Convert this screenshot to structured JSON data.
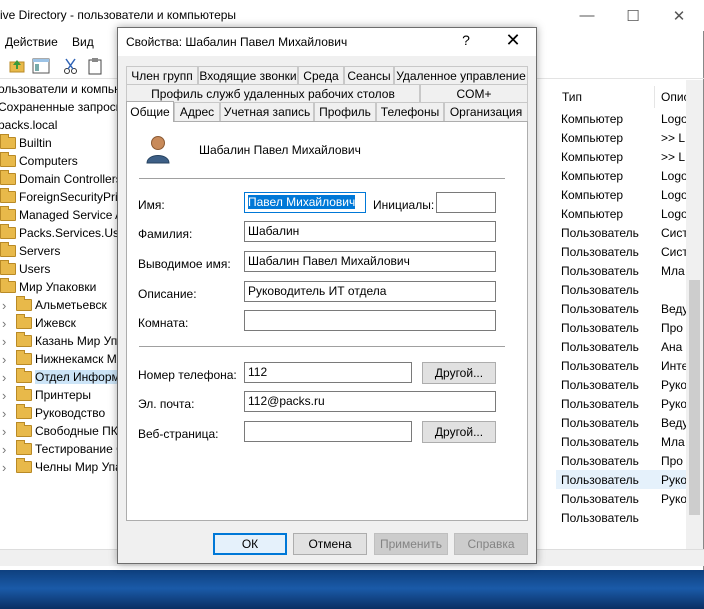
{
  "main_window": {
    "title": "ive Directory - пользователи и компьютеры",
    "menu": [
      "Действие",
      "Вид"
    ],
    "tree": [
      {
        "label": "ользователи и компьют",
        "indent": 0,
        "folder": false
      },
      {
        "label": "Сохраненные запросы",
        "indent": 0,
        "folder": false
      },
      {
        "label": "packs.local",
        "indent": 0,
        "folder": false
      },
      {
        "label": "Builtin",
        "indent": 1,
        "folder": true
      },
      {
        "label": "Computers",
        "indent": 1,
        "folder": true
      },
      {
        "label": "Domain Controllers",
        "indent": 1,
        "folder": true
      },
      {
        "label": "ForeignSecurityPrin",
        "indent": 1,
        "folder": true
      },
      {
        "label": "Managed Service A",
        "indent": 1,
        "folder": true
      },
      {
        "label": "Packs.Services.Users",
        "indent": 1,
        "folder": true
      },
      {
        "label": "Servers",
        "indent": 1,
        "folder": true
      },
      {
        "label": "Users",
        "indent": 1,
        "folder": true
      },
      {
        "label": "Мир Упаковки",
        "indent": 1,
        "folder": true
      },
      {
        "label": "Альметьевск",
        "indent": 2,
        "folder": true
      },
      {
        "label": "Ижевск",
        "indent": 2,
        "folder": true
      },
      {
        "label": "Казань Мир Упа",
        "indent": 2,
        "folder": true
      },
      {
        "label": "Нижнекамск М",
        "indent": 2,
        "folder": true
      },
      {
        "label": "Отдел Информ",
        "indent": 2,
        "folder": true,
        "selected": true
      },
      {
        "label": "Принтеры",
        "indent": 2,
        "folder": true
      },
      {
        "label": "Руководство",
        "indent": 2,
        "folder": true
      },
      {
        "label": "Свободные ПК",
        "indent": 2,
        "folder": true
      },
      {
        "label": "Тестирование С",
        "indent": 2,
        "folder": true
      },
      {
        "label": "Челны Мир Упа",
        "indent": 2,
        "folder": true
      }
    ],
    "columns": [
      "Тип",
      "Опис"
    ],
    "rows": [
      {
        "type": "Компьютер",
        "desc": "Logo"
      },
      {
        "type": "Компьютер",
        "desc": ">> L"
      },
      {
        "type": "Компьютер",
        "desc": ">> L"
      },
      {
        "type": "Компьютер",
        "desc": "Logo"
      },
      {
        "type": "Компьютер",
        "desc": "Logo"
      },
      {
        "type": "Компьютер",
        "desc": "Logo"
      },
      {
        "type": "Пользователь",
        "desc": "Сист"
      },
      {
        "type": "Пользователь",
        "desc": "Сист"
      },
      {
        "type": "Пользователь",
        "desc": "Мла"
      },
      {
        "type": "Пользователь",
        "desc": ""
      },
      {
        "type": "Пользователь",
        "desc": "Веду"
      },
      {
        "type": "Пользователь",
        "desc": "Про"
      },
      {
        "type": "Пользователь",
        "desc": "Ана"
      },
      {
        "type": "Пользователь",
        "desc": "Инте"
      },
      {
        "type": "Пользователь",
        "desc": "Руко"
      },
      {
        "type": "Пользователь",
        "desc": "Руко"
      },
      {
        "type": "Пользователь",
        "desc": "Веду"
      },
      {
        "type": "Пользователь",
        "desc": "Мла"
      },
      {
        "type": "Пользователь",
        "desc": "Про"
      },
      {
        "type": "Пользователь",
        "desc": "Руко",
        "selected": true
      },
      {
        "type": "Пользователь",
        "desc": "Руко"
      },
      {
        "type": "Пользователь",
        "desc": ""
      }
    ]
  },
  "dialog": {
    "title": "Свойства: Шабалин Павел Михайлович",
    "help": "?",
    "close": "✕",
    "tabs_row1": [
      "Член групп",
      "Входящие звонки",
      "Среда",
      "Сеансы",
      "Удаленное управление"
    ],
    "tabs_row2": [
      "Профиль служб удаленных рабочих столов",
      "COM+"
    ],
    "tabs_row3": [
      "Общие",
      "Адрес",
      "Учетная запись",
      "Профиль",
      "Телефоны",
      "Организация"
    ],
    "active_tab": "Общие",
    "display_header": "Шабалин Павел Михайлович",
    "labels": {
      "first_name": "Имя:",
      "initials": "Инициалы:",
      "last_name": "Фамилия:",
      "display_name": "Выводимое имя:",
      "description": "Описание:",
      "office": "Комната:",
      "phone": "Номер телефона:",
      "email": "Эл. почта:",
      "web": "Веб-страница:"
    },
    "values": {
      "first_name": "Павел Михайлович",
      "initials": "",
      "last_name": "Шабалин",
      "display_name": "Шабалин Павел Михайлович",
      "description": "Руководитель ИТ отдела",
      "office": "",
      "phone": "112",
      "email": "112@packs.ru",
      "web": ""
    },
    "other_button": "Другой...",
    "buttons": {
      "ok": "ОК",
      "cancel": "Отмена",
      "apply": "Применить",
      "help": "Справка"
    }
  },
  "icons": [
    "user-icon",
    "folder-icon",
    "help-icon",
    "close-icon",
    "minimize-icon",
    "maximize-icon"
  ]
}
